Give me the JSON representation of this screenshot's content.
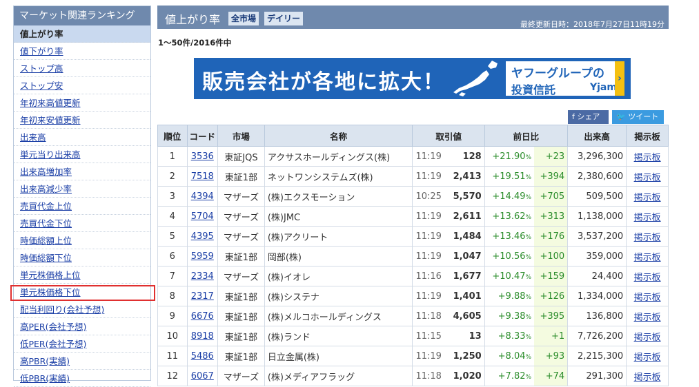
{
  "sidebar": {
    "title": "マーケット関連ランキング",
    "items": [
      {
        "label": "値上がり率",
        "active": true
      },
      {
        "label": "値下がり率"
      },
      {
        "label": "ストップ高"
      },
      {
        "label": "ストップ安"
      },
      {
        "label": "年初来高値更新"
      },
      {
        "label": "年初来安値更新"
      },
      {
        "label": "出来高"
      },
      {
        "label": "単元当り出来高"
      },
      {
        "label": "出来高増加率"
      },
      {
        "label": "出来高減少率"
      },
      {
        "label": "売買代金上位"
      },
      {
        "label": "売買代金下位"
      },
      {
        "label": "時価総額上位"
      },
      {
        "label": "時価総額下位"
      },
      {
        "label": "単元株価格上位"
      },
      {
        "label": "単元株価格下位"
      },
      {
        "label": "配当利回り(会社予想)"
      },
      {
        "label": "高PER(会社予想)"
      },
      {
        "label": "低PER(会社予想)"
      },
      {
        "label": "高PBR(実績)"
      },
      {
        "label": "低PBR(実績)"
      }
    ]
  },
  "header": {
    "title": "値上がり率",
    "tab_market": "全市場",
    "tab_period": "デイリー",
    "updated": "最終更新日時：2018年7月27日11時19分"
  },
  "count_text": "1〜50件/2016件中",
  "banner": {
    "headline": "販売会社が各地に拡大！",
    "line1": "ヤフーグループの",
    "line2": "投資信託",
    "logo": "Yjam",
    "arrow": "›"
  },
  "share": {
    "facebook": "f シェア",
    "twitter": "ツイート"
  },
  "table": {
    "headers": {
      "rank": "順位",
      "code": "コード",
      "market": "市場",
      "name": "名称",
      "price": "取引値",
      "change": "前日比",
      "volume": "出来高",
      "board": "掲示板"
    },
    "rows": [
      {
        "rank": "1",
        "code": "3536",
        "market": "東証JQS",
        "name": "アクサスホールディングス(株)",
        "time": "11:19",
        "price": "128",
        "pct": "+21.90",
        "chg": "+23",
        "volume": "3,296,300",
        "board": "掲示板"
      },
      {
        "rank": "2",
        "code": "7518",
        "market": "東証1部",
        "name": "ネットワンシステムズ(株)",
        "time": "11:19",
        "price": "2,413",
        "pct": "+19.51",
        "chg": "+394",
        "volume": "2,380,600",
        "board": "掲示板"
      },
      {
        "rank": "3",
        "code": "4394",
        "market": "マザーズ",
        "name": "(株)エクスモーション",
        "time": "10:25",
        "price": "5,570",
        "pct": "+14.49",
        "chg": "+705",
        "volume": "509,500",
        "board": "掲示板"
      },
      {
        "rank": "4",
        "code": "5704",
        "market": "マザーズ",
        "name": "(株)JMC",
        "time": "11:19",
        "price": "2,611",
        "pct": "+13.62",
        "chg": "+313",
        "volume": "1,138,000",
        "board": "掲示板"
      },
      {
        "rank": "5",
        "code": "4395",
        "market": "マザーズ",
        "name": "(株)アクリート",
        "time": "11:19",
        "price": "1,484",
        "pct": "+13.46",
        "chg": "+176",
        "volume": "3,537,200",
        "board": "掲示板"
      },
      {
        "rank": "6",
        "code": "5959",
        "market": "東証1部",
        "name": "岡部(株)",
        "time": "11:19",
        "price": "1,047",
        "pct": "+10.56",
        "chg": "+100",
        "volume": "359,000",
        "board": "掲示板"
      },
      {
        "rank": "7",
        "code": "2334",
        "market": "マザーズ",
        "name": "(株)イオレ",
        "time": "11:16",
        "price": "1,677",
        "pct": "+10.47",
        "chg": "+159",
        "volume": "24,400",
        "board": "掲示板"
      },
      {
        "rank": "8",
        "code": "2317",
        "market": "東証1部",
        "name": "(株)システナ",
        "time": "11:19",
        "price": "1,401",
        "pct": "+9.88",
        "chg": "+126",
        "volume": "1,334,000",
        "board": "掲示板"
      },
      {
        "rank": "9",
        "code": "6676",
        "market": "東証1部",
        "name": "(株)メルコホールディングス",
        "time": "11:18",
        "price": "4,605",
        "pct": "+9.38",
        "chg": "+395",
        "volume": "136,800",
        "board": "掲示板"
      },
      {
        "rank": "10",
        "code": "8918",
        "market": "東証1部",
        "name": "(株)ランド",
        "time": "11:15",
        "price": "13",
        "pct": "+8.33",
        "chg": "+1",
        "volume": "7,726,200",
        "board": "掲示板"
      },
      {
        "rank": "11",
        "code": "5486",
        "market": "東証1部",
        "name": "日立金属(株)",
        "time": "11:19",
        "price": "1,250",
        "pct": "+8.04",
        "chg": "+93",
        "volume": "2,215,300",
        "board": "掲示板"
      },
      {
        "rank": "12",
        "code": "6067",
        "market": "マザーズ",
        "name": "(株)メディアフラッグ",
        "time": "11:18",
        "price": "1,020",
        "pct": "+7.82",
        "chg": "+74",
        "volume": "291,300",
        "board": "掲示板"
      }
    ],
    "pct_unit": "%"
  },
  "colors": {
    "header_bg": "#6f89ad",
    "link": "#1a3ea6",
    "positive": "#2a8c2a",
    "highlight": "#e03030",
    "banner_bg": "#1f64b8"
  }
}
